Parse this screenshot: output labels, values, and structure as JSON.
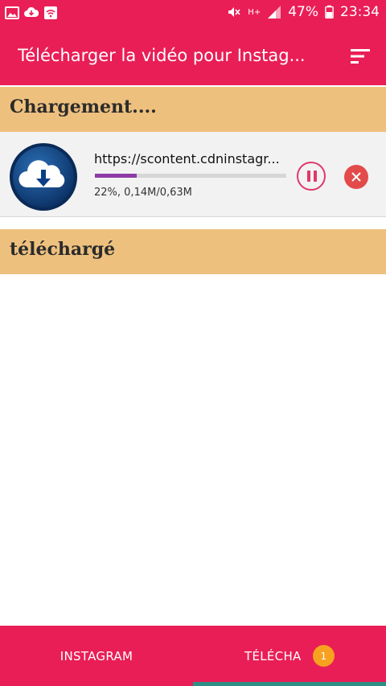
{
  "status_bar": {
    "battery": "47%",
    "time": "23:34",
    "signal_label": "H+"
  },
  "app_bar": {
    "title": "Télécharger la vidéo pour Instag..."
  },
  "sections": {
    "loading_title": "Chargement....",
    "downloaded_title": "téléchargé"
  },
  "download": {
    "url": "https://scontent.cdninstagr...",
    "status": "22%, 0,14M/0,63M",
    "progress_fraction": 0.22
  },
  "bottom_nav": {
    "tab_instagram": "INSTAGRAM",
    "tab_downloads": "TÉLÉCHA",
    "badge_count": "1"
  },
  "colors": {
    "primary": "#e91e56",
    "section_bg": "#eec07e",
    "progress": "#8e3aa8",
    "badge": "#f7a11f",
    "cancel": "#e34b4b",
    "indicator": "#2f8f86"
  }
}
